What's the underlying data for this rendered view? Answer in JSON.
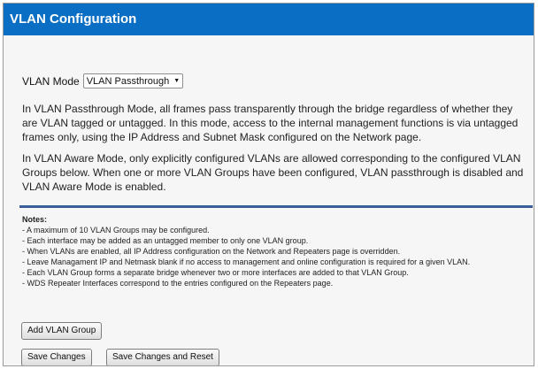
{
  "header": {
    "title": "VLAN Configuration"
  },
  "vlan_mode": {
    "label": "VLAN Mode",
    "selected": "VLAN Passthrough"
  },
  "description": {
    "passthrough": "In VLAN Passthrough Mode, all frames pass transparently through the bridge regardless of whether they are VLAN tagged or untagged. In this mode, access to the internal management functions is via untagged frames only, using the IP Address and Subnet Mask configured on the Network page.",
    "aware": "In VLAN Aware Mode, only explicitly configured VLANs are allowed corresponding to the configured VLAN Groups below. When one or more VLAN Groups have been configured, VLAN passthrough is disabled and VLAN Aware Mode is enabled."
  },
  "notes": {
    "title": "Notes:",
    "items": [
      "- A maximum of 10 VLAN Groups may be configured.",
      "- Each interface may be added as an untagged member to only one VLAN group.",
      "- When VLANs are enabled, all IP Address configuration on the Network and Repeaters page is overridden.",
      "- Leave Managament IP and Netmask blank if no access to management and online configuration is required for a given VLAN.",
      "- Each VLAN Group forms a separate bridge whenever two or more interfaces are added to that VLAN Group.",
      "- WDS Repeater Interfaces correspond to the entries configured on the Repeaters page."
    ]
  },
  "buttons": {
    "add_vlan_group": "Add VLAN Group",
    "save_changes": "Save Changes",
    "save_changes_reset": "Save Changes and Reset"
  },
  "colors": {
    "header_bg": "#0a6ec4",
    "rule": "#3a5f9a"
  }
}
